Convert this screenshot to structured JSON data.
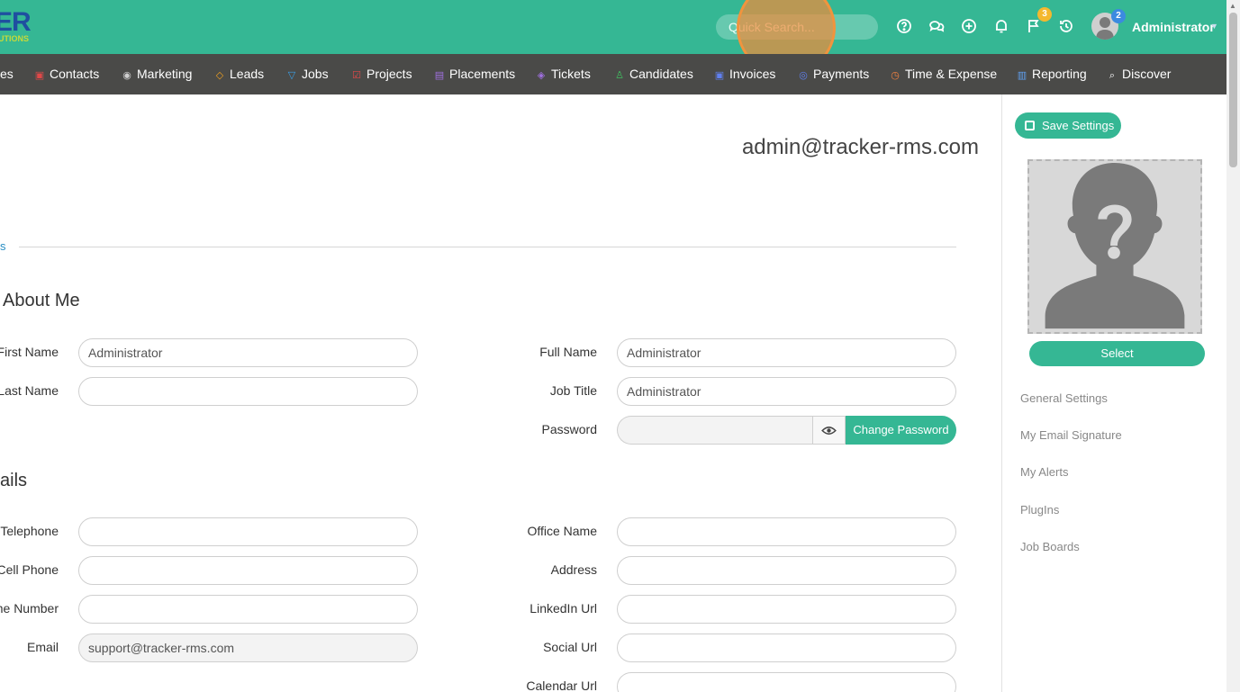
{
  "app": {
    "logo_text": "ER",
    "logo_sub": "UTIONS"
  },
  "header": {
    "quick_search_placeholder": "Quick Search...",
    "flag_badge": "3",
    "avatar_badge": "2",
    "user_name": "Administrator",
    "icons": [
      "help-icon",
      "chat-icon",
      "add-icon",
      "bell-icon",
      "flag-icon",
      "history-icon"
    ]
  },
  "nav": {
    "items": [
      {
        "label": "es",
        "icon": ""
      },
      {
        "label": "Contacts",
        "icon": "contacts-icon",
        "color": "#e04848"
      },
      {
        "label": "Marketing",
        "icon": "broadcast-icon",
        "color": "#cfcfcf"
      },
      {
        "label": "Leads",
        "icon": "diamond-icon",
        "color": "#f0a020"
      },
      {
        "label": "Jobs",
        "icon": "trophy-icon",
        "color": "#3aa0e8"
      },
      {
        "label": "Projects",
        "icon": "checkbox-icon",
        "color": "#e04848"
      },
      {
        "label": "Placements",
        "icon": "briefcase-icon",
        "color": "#a070e0"
      },
      {
        "label": "Tickets",
        "icon": "tag-icon",
        "color": "#a070e0"
      },
      {
        "label": "Candidates",
        "icon": "person-icon",
        "color": "#40c060"
      },
      {
        "label": "Invoices",
        "icon": "invoice-icon",
        "color": "#6080f0"
      },
      {
        "label": "Payments",
        "icon": "payment-icon",
        "color": "#6080f0"
      },
      {
        "label": "Time & Expense",
        "icon": "clock-icon",
        "color": "#f08040"
      },
      {
        "label": "Reporting",
        "icon": "bar-chart-icon",
        "color": "#60a0f0"
      },
      {
        "label": "Discover",
        "icon": "search-icon",
        "color": "#ffffff"
      }
    ]
  },
  "main": {
    "email_title": "admin@tracker-rms.com",
    "tab_fragment": "s",
    "about_me": {
      "heading": "About Me",
      "first_name_label": "First Name",
      "first_name_value": "Administrator",
      "last_name_label": "Last Name",
      "last_name_value": "",
      "full_name_label": "Full Name",
      "full_name_value": "Administrator",
      "job_title_label": "Job Title",
      "job_title_value": "Administrator",
      "password_label": "Password",
      "change_password_label": "Change Password"
    },
    "details": {
      "heading": "ails",
      "telephone_label": "Telephone",
      "cell_phone_label": "Cell Phone",
      "phone_number_label": "ne Number",
      "email_label": "Email",
      "email_value": "support@tracker-rms.com",
      "office_name_label": "Office Name",
      "address_label": "Address",
      "linkedin_label": "LinkedIn Url",
      "social_label": "Social Url",
      "calendar_label": "Calendar Url"
    }
  },
  "sidebar": {
    "save_settings": "Save Settings",
    "select_label": "Select",
    "links": [
      "General Settings",
      "My Email Signature",
      "My Alerts",
      "PlugIns",
      "Job Boards"
    ]
  },
  "colors": {
    "brand": "#35b794",
    "navbar": "#4a4a48"
  }
}
